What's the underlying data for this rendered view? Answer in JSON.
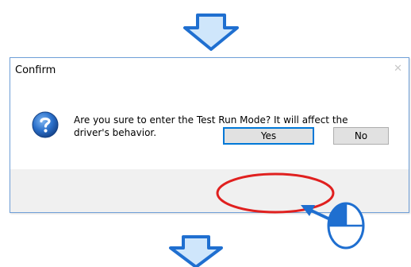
{
  "dialog": {
    "title": "Confirm",
    "close_glyph": "✕",
    "icon": "question-icon",
    "message": "Are you sure to enter the Test Run Mode? It will affect the driver's behavior.",
    "buttons": {
      "yes_label": "Yes",
      "no_label": "No"
    }
  },
  "annotations": {
    "flow_arrows": [
      "down-arrow",
      "down-arrow"
    ],
    "highlight": "yes-button",
    "pointer": "mouse-left-click-icon"
  },
  "colors": {
    "arrow_fill": "#cfe6fb",
    "arrow_stroke": "#1f6fd0",
    "highlight_ring": "#e0201f",
    "dialog_border": "#6f9fd8",
    "button_focus": "#0078d7",
    "question_icon": "#2a6fc9"
  }
}
